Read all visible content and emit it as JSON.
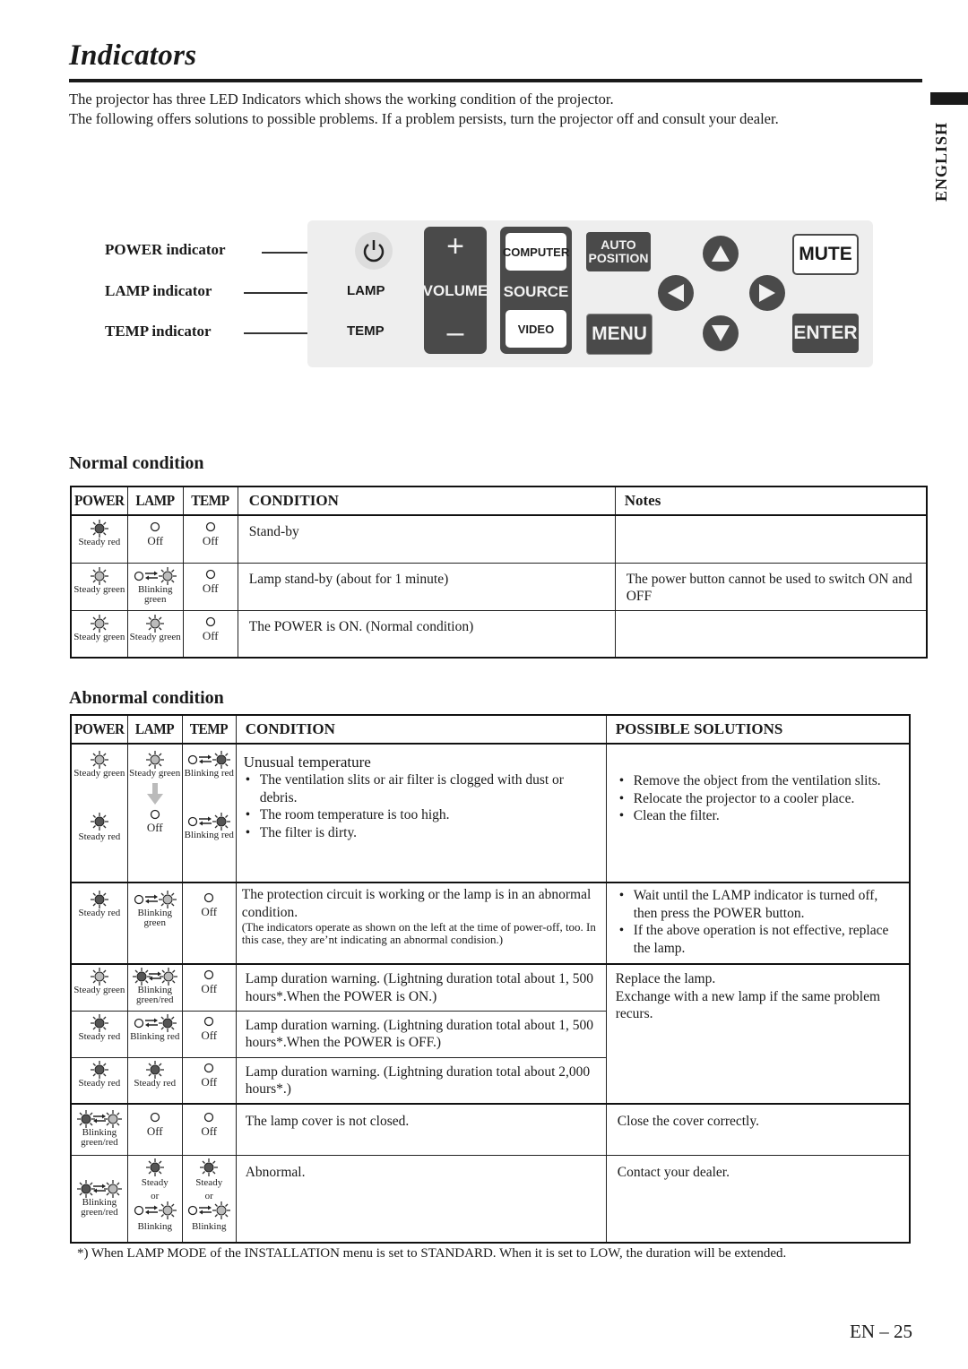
{
  "page": {
    "title": "Indicators",
    "intro_line1": "The projector has three LED Indicators which shows the working condition of the projector.",
    "intro_line2": "The following offers solutions to possible problems. If a problem persists, turn the projector off and consult your dealer.",
    "language_tab": "ENGLISH",
    "footnote": "*) When LAMP MODE of the INSTALLATION menu is set to STANDARD. When it is set to LOW, the duration will be extended.",
    "page_number": "EN – 25"
  },
  "panel": {
    "indicator_labels": [
      "POWER indicator",
      "LAMP indicator",
      "TEMP indicator"
    ],
    "led_labels": {
      "lamp": "LAMP",
      "temp": "TEMP"
    },
    "icons": {
      "power": "power-icon"
    },
    "buttons": {
      "volume_plus": "+",
      "volume": "VOLUME",
      "volume_minus": "–",
      "computer": "COMPUTER",
      "source": "SOURCE",
      "video": "VIDEO",
      "auto_position_1": "AUTO",
      "auto_position_2": "POSITION",
      "menu": "MENU",
      "mute": "MUTE",
      "enter": "ENTER"
    },
    "colors": {
      "panel_bg": "#eeeeee",
      "button_dark": "#4a4a4a"
    }
  },
  "normal": {
    "heading": "Normal condition",
    "headers": [
      "POWER",
      "LAMP",
      "TEMP",
      "CONDITION",
      "Notes"
    ],
    "rows": [
      {
        "power": {
          "sym": "red",
          "label": "Steady red"
        },
        "lamp": {
          "sym": "off",
          "label": "Off"
        },
        "temp": {
          "sym": "off",
          "label": "Off"
        },
        "condition": "Stand-by",
        "notes": ""
      },
      {
        "power": {
          "sym": "green",
          "label": "Steady green"
        },
        "lamp": {
          "sym": "blink-green",
          "label": "Blinking green"
        },
        "temp": {
          "sym": "off",
          "label": "Off"
        },
        "condition": "Lamp stand-by (about for 1 minute)",
        "notes": "The power button cannot be used to switch ON and OFF"
      },
      {
        "power": {
          "sym": "green",
          "label": "Steady green"
        },
        "lamp": {
          "sym": "green",
          "label": "Steady green"
        },
        "temp": {
          "sym": "off",
          "label": "Off"
        },
        "condition": "The POWER is ON. (Normal condition)",
        "notes": ""
      }
    ]
  },
  "abnormal": {
    "heading": "Abnormal condition",
    "headers": [
      "POWER",
      "LAMP",
      "TEMP",
      "CONDITION",
      "POSSIBLE SOLUTIONS"
    ],
    "row1": {
      "power_top": "Steady green",
      "lamp_top": "Steady green",
      "temp_top": "Blinking red",
      "power_bottom": "Steady red",
      "lamp_bottom": "Off",
      "temp_bottom": "Blinking red",
      "condition_title": "Unusual temperature",
      "condition_bullets": [
        "The ventilation slits or air filter is clogged with dust or debris.",
        "The room temperature is too high.",
        "The filter is dirty."
      ],
      "solutions": [
        "Remove the object from the ventilation slits.",
        "Relocate the projector to a cooler place.",
        "Clean the filter."
      ]
    },
    "row2": {
      "power": "Steady red",
      "lamp": "Blinking green",
      "temp": "Off",
      "condition": "The protection circuit is working or the lamp is in an abnormal condition.",
      "condition_note": "(The indicators operate as shown on the left at the time of power-off, too. In this case, they are’nt indicating an abnormal condision.)",
      "solutions": [
        "Wait until the LAMP indicator is turned off, then press the POWER button.",
        "If the above operation is not effective, replace the lamp."
      ]
    },
    "row3": {
      "power": "Steady green",
      "lamp": "Blinking green/red",
      "temp": "Off",
      "condition": "Lamp duration warning. (Lightning duration total about 1, 500 hours*.When the POWER is ON.)"
    },
    "row4": {
      "power": "Steady red",
      "lamp": "Blinking red",
      "temp": "Off",
      "condition": "Lamp duration warning. (Lightning duration total about 1, 500 hours*.When the POWER is OFF.)"
    },
    "row5": {
      "power": "Steady red",
      "lamp": "Steady red",
      "temp": "Off",
      "condition": "Lamp duration warning. (Lightning duration total about 2,000 hours*.)"
    },
    "rows345_solution": [
      "Replace the lamp.",
      "Exchange with a new lamp if the same problem recurs."
    ],
    "row6": {
      "power": "Blinking green/red",
      "lamp": "Off",
      "temp": "Off",
      "condition": "The lamp cover is not closed.",
      "solution": "Close the cover correctly."
    },
    "row7": {
      "power": "Blinking green/red",
      "lamp_steady": "Steady",
      "lamp_or": "or",
      "lamp_blink": "Blinking",
      "temp_steady": "Steady",
      "temp_or": "or",
      "temp_blink": "Blinking",
      "condition": "Abnormal.",
      "solution": "Contact your dealer."
    }
  }
}
